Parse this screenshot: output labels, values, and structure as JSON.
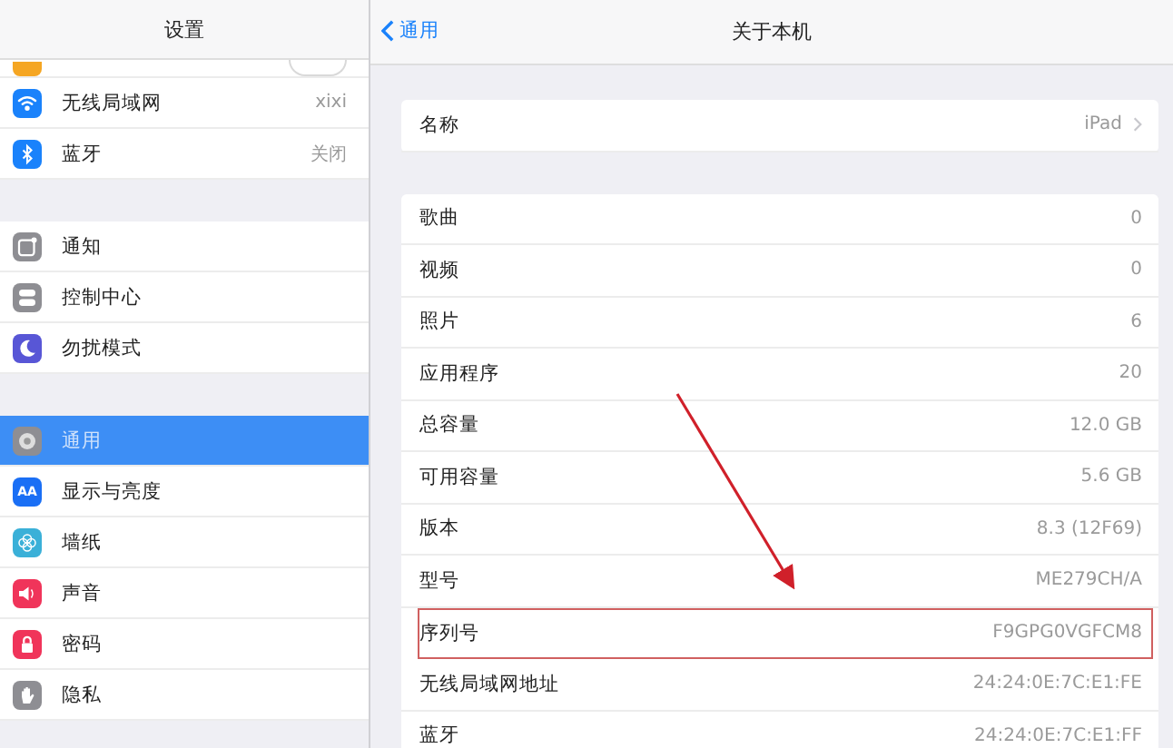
{
  "sidebar": {
    "title": "设置",
    "groups": [
      [
        {
          "color": "#f5a623",
          "selected": false,
          "toggle": {
            "on": false
          }
        },
        {
          "label": "无线局域网",
          "value": "xixi",
          "color": "#1a82fb",
          "selected": false
        },
        {
          "label": "蓝牙",
          "value": "关闭",
          "color": "#1a82fb",
          "selected": false
        }
      ],
      [
        {
          "label": "通知",
          "color": "#8e8e93",
          "selected": false
        },
        {
          "label": "控制中心",
          "color": "#8e8e93",
          "selected": false
        },
        {
          "label": "勿扰模式",
          "color": "#5856d6",
          "selected": false
        }
      ],
      [
        {
          "label": "通用",
          "color": "#8e8e93",
          "selected": true
        },
        {
          "label": "显示与亮度",
          "color": "#1a6ff5",
          "selected": false,
          "icon_text": "AA"
        },
        {
          "label": "墙纸",
          "color": "#3ab0d8",
          "selected": false
        },
        {
          "label": "声音",
          "color": "#f0345a",
          "selected": false
        },
        {
          "label": "密码",
          "color": "#f0345a",
          "selected": false
        },
        {
          "label": "隐私",
          "color": "#8e8e93",
          "selected": false
        }
      ]
    ]
  },
  "about": {
    "back": "通用",
    "title": "关于本机",
    "name_row": {
      "label": "名称",
      "value": "iPad"
    },
    "rows": [
      {
        "label": "歌曲",
        "value": "0",
        "highlighted": false
      },
      {
        "label": "视频",
        "value": "0",
        "highlighted": false
      },
      {
        "label": "照片",
        "value": "6",
        "highlighted": false
      },
      {
        "label": "应用程序",
        "value": "20",
        "highlighted": false
      },
      {
        "label": "总容量",
        "value": "12.0 GB",
        "highlighted": false
      },
      {
        "label": "可用容量",
        "value": "5.6 GB",
        "highlighted": false
      },
      {
        "label": "版本",
        "value": "8.3 (12F69)",
        "highlighted": false
      },
      {
        "label": "型号",
        "value": "ME279CH/A",
        "highlighted": false
      },
      {
        "label": "序列号",
        "value": "F9GPG0VGFCM8",
        "highlighted": true
      },
      {
        "label": "无线局域网地址",
        "value": "24:24:0E:7C:E1:FE",
        "highlighted": false
      },
      {
        "label": "蓝牙",
        "value": "24:24:0E:7C:E1:FF",
        "highlighted": false
      }
    ]
  }
}
